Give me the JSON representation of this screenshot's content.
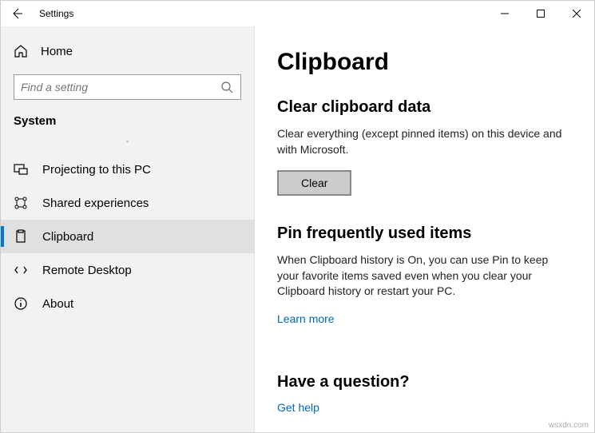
{
  "titlebar": {
    "title": "Settings"
  },
  "sidebar": {
    "home": "Home",
    "search_placeholder": "Find a setting",
    "category": "System",
    "items": [
      {
        "label": "Projecting to this PC"
      },
      {
        "label": "Shared experiences"
      },
      {
        "label": "Clipboard"
      },
      {
        "label": "Remote Desktop"
      },
      {
        "label": "About"
      }
    ]
  },
  "main": {
    "title": "Clipboard",
    "clear_section": {
      "title": "Clear clipboard data",
      "desc": "Clear everything (except pinned items) on this device and with Microsoft.",
      "button": "Clear"
    },
    "pin_section": {
      "title": "Pin frequently used items",
      "desc": "When Clipboard history is On, you can use Pin to keep your favorite items saved even when you clear your Clipboard history or restart your PC.",
      "link": "Learn more"
    },
    "question_section": {
      "title": "Have a question?",
      "link": "Get help"
    }
  },
  "watermark": "wsxdn.com"
}
